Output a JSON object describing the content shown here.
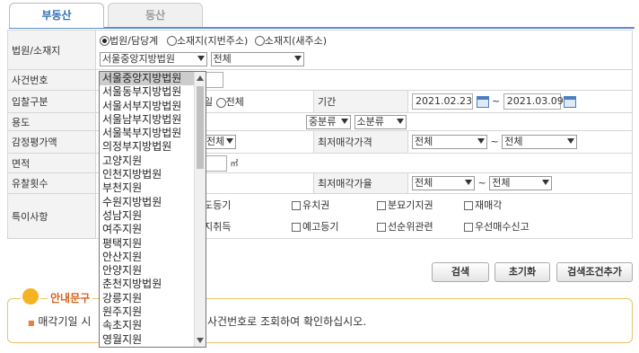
{
  "tabs": [
    {
      "label": "부동산"
    },
    {
      "label": "동산"
    }
  ],
  "form": {
    "court_label": "법원/소재지",
    "radio_court": "법원/담당계",
    "radio_lot": "소재지(지번주소)",
    "radio_road": "소재지(새주소)",
    "court_select": "서울중앙지방법원",
    "dept_select": "전체",
    "case_label": "사건번호",
    "bid_label": "입찰구분",
    "bid_opt_suffix": "일",
    "bid_opt_all": "전체",
    "period_label": "기간",
    "date_from": "2021.02.23",
    "date_to": "2021.03.09",
    "tilde": "~",
    "use_label": "용도",
    "mid_class": "중분류",
    "sub_class": "소분류",
    "appraisal_label": "감정평가액",
    "appraisal_select": "전체",
    "min_price_label": "최저매각가격",
    "min_price_from": "전체",
    "min_price_to": "전체",
    "area_label": "면적",
    "area_unit": "㎡",
    "fail_label": "유찰횟수",
    "min_rate_label": "최저매각가율",
    "min_rate_from": "전체",
    "min_rate_to": "전체",
    "special_label": "특이사항",
    "special_row1": [
      "도등기",
      "유치권",
      "분묘기지권",
      "재매각"
    ],
    "special_row2": [
      "지취득",
      "예고등기",
      "선순위관련",
      "우선매수신고"
    ]
  },
  "buttons": {
    "search": "검색",
    "reset": "초기화",
    "add_cond": "검색조건추가"
  },
  "notice": {
    "title": "안내문구",
    "text_left": "매각기일 시",
    "text_right": "사건번호로 조회하여 확인하십시오."
  },
  "dropdown": {
    "items": [
      "서울중앙지방법원",
      "서울동부지방법원",
      "서울서부지방법원",
      "서울남부지방법원",
      "서울북부지방법원",
      "의정부지방법원",
      "고양지원",
      "인천지방법원",
      "부천지원",
      "수원지방법원",
      "성남지원",
      "여주지원",
      "평택지원",
      "안산지원",
      "안양지원",
      "춘천지방법원",
      "강릉지원",
      "원주지원",
      "속초지원",
      "영월지원"
    ],
    "selected_index": 0
  }
}
